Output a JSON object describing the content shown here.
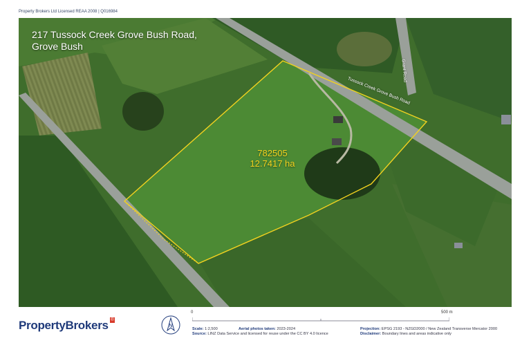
{
  "licence_text": "Property Brokers Ltd Licensed REAA 2008 | Q016984",
  "address": {
    "line1": "217 Tussock Creek Grove Bush Road,",
    "line2": "Grove Bush"
  },
  "parcel": {
    "id": "782505",
    "area": "12.7417 ha"
  },
  "roads": {
    "main": "Tussock Creek Grove Bush Road",
    "side": "Grant Road"
  },
  "footer": {
    "logo_text": "PropertyBrokers",
    "logo_badge": "®",
    "north_label": "N",
    "scale_zero": "0",
    "scale_end": "500 m",
    "scale_label": "Scale:",
    "scale_value": "1:2,500",
    "aerial_label": "Aerial photos taken:",
    "aerial_value": "2023-2024",
    "source_label": "Source:",
    "source_value": "LINZ Data Service and licensed for reuse under the CC BY 4.0 licence",
    "projection_label": "Projection:",
    "projection_value": "EPSG 2193 - NZGD2000 / New Zealand Transverse Mercator 2000",
    "disclaimer_label": "Disclaimer:",
    "disclaimer_value": "Boundary lines and areas indicative only"
  },
  "colors": {
    "boundary": "#f2d21f",
    "brand": "#1f3a7a",
    "accent": "#d83a2a"
  }
}
